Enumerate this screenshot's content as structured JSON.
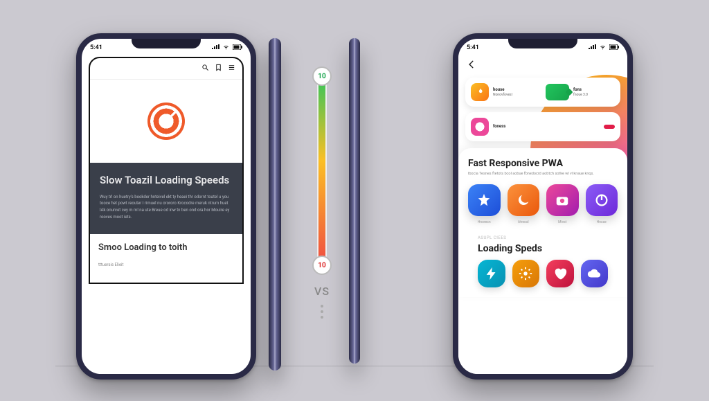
{
  "status": {
    "time": "5:41"
  },
  "center": {
    "top_value": "10",
    "bottom_value": "10",
    "vs": "VS"
  },
  "left_phone": {
    "headline": "Slow Toazil Loading Speeds",
    "body": "Wuy trl on huetry's bookder hnteivel ekt ty heaei thr odornt toatel u you tooce het powt reouter I rimuel nu orororo Krocodre meruk ntrum huet lAk onurcet cey m ml na ute Breue od inw tn ben ond ora hor Mouire ey rooves moot iets.",
    "card_title": "Smoo Loading to toith",
    "card_sub": "tttuersis Elieit"
  },
  "right_phone": {
    "top_cards": [
      {
        "title": "house",
        "sub": "Nonovfovesl"
      },
      {
        "title": "fons",
        "sub": "fnoue 3.0"
      }
    ],
    "row2": {
      "title": "foness",
      "sub": "",
      "badge_label": ""
    },
    "main": {
      "title": "Fast Responsive PWA",
      "sub": "lbocia Tesnes ftetots bcol aobue fbnedocrd aobtch sotke wl vl knaue knqs.",
      "tile_labels": [
        "Hnoresn",
        "Atreosl",
        "Mivst",
        "Hnsse"
      ]
    },
    "section2": {
      "kicker": "ASUPL CIEES",
      "title": "Loading Speds"
    }
  }
}
